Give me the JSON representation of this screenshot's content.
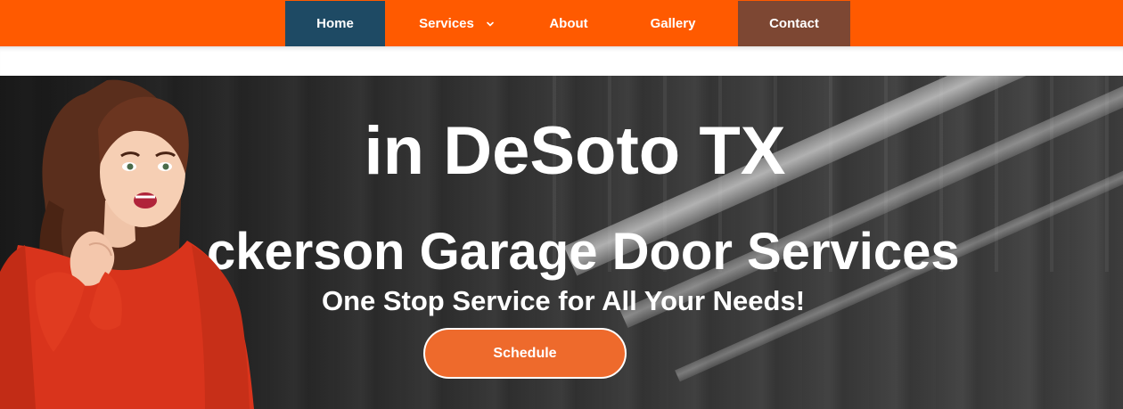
{
  "nav": {
    "items": [
      {
        "label": "Home"
      },
      {
        "label": "Services"
      },
      {
        "label": "About"
      },
      {
        "label": "Gallery"
      },
      {
        "label": "Contact"
      }
    ]
  },
  "hero": {
    "line1": "in DeSoto TX",
    "line2": "ckerson Garage Door Services",
    "line3": "One Stop Service for All Your Needs!",
    "button_label": "Schedule"
  },
  "colors": {
    "nav_bg": "#ff5a00",
    "home_bg": "#1e4a64",
    "contact_bg": "#7d4733",
    "button_bg": "#ee6a2c"
  },
  "icons": {
    "services_dropdown": "chevron-down-icon"
  }
}
